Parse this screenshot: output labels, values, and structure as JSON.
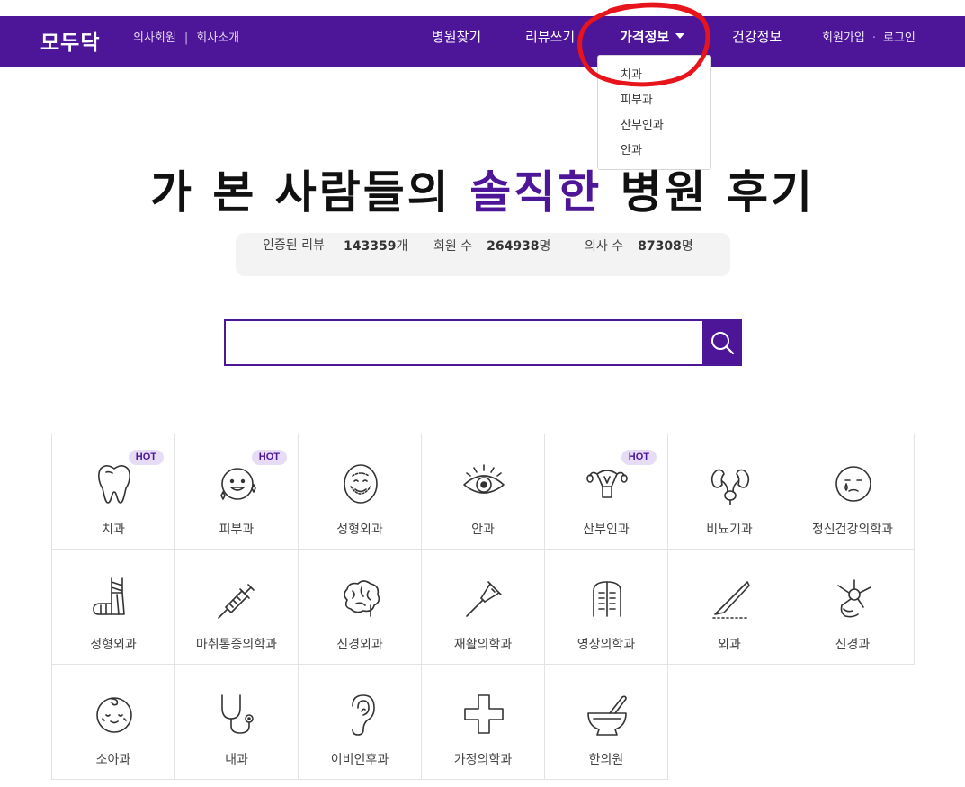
{
  "header": {
    "logo": "모두닥",
    "sub_links": [
      "의사회원",
      "회사소개"
    ],
    "sub_separator": "|",
    "nav": {
      "hospital": "병원찾기",
      "review": "리뷰쓰기",
      "price": "가격정보",
      "health": "건강정보"
    },
    "signup": "회원가입",
    "dot": "·",
    "login": "로그인"
  },
  "price_dropdown": {
    "items": [
      "치과",
      "피부과",
      "산부인과",
      "안과"
    ]
  },
  "hero": {
    "title_before": "가 본 사람들의 ",
    "title_accent": "솔직한",
    "title_after": " 병원 후기",
    "accent_color": "#4d1699"
  },
  "stats": {
    "reviews_label": "인증된 리뷰",
    "reviews_value": "143359",
    "reviews_unit": "개",
    "members_label": "회원 수",
    "members_value": "264938",
    "members_unit": "명",
    "doctors_label": "의사 수",
    "doctors_value": "87308",
    "doctors_unit": "명"
  },
  "search": {
    "placeholder": "",
    "value": ""
  },
  "categories": [
    {
      "label": "치과",
      "icon": "tooth-icon",
      "hot": true
    },
    {
      "label": "피부과",
      "icon": "sparkle-face-icon",
      "hot": true
    },
    {
      "label": "성형외과",
      "icon": "surgery-face-icon",
      "hot": false
    },
    {
      "label": "안과",
      "icon": "eye-icon",
      "hot": false
    },
    {
      "label": "산부인과",
      "icon": "uterus-icon",
      "hot": true
    },
    {
      "label": "비뇨기과",
      "icon": "kidney-icon",
      "hot": false
    },
    {
      "label": "정신건강의학과",
      "icon": "crying-face-icon",
      "hot": false
    },
    {
      "label": "정형외과",
      "icon": "cast-leg-icon",
      "hot": false
    },
    {
      "label": "마취통증의학과",
      "icon": "syringe-icon",
      "hot": false
    },
    {
      "label": "신경외과",
      "icon": "brain-icon",
      "hot": false
    },
    {
      "label": "재활의학과",
      "icon": "crutch-icon",
      "hot": false
    },
    {
      "label": "영상의학과",
      "icon": "xray-icon",
      "hot": false
    },
    {
      "label": "외과",
      "icon": "scalpel-icon",
      "hot": false
    },
    {
      "label": "신경과",
      "icon": "neuron-icon",
      "hot": false
    },
    {
      "label": "소아과",
      "icon": "baby-face-icon",
      "hot": false
    },
    {
      "label": "내과",
      "icon": "stethoscope-icon",
      "hot": false
    },
    {
      "label": "이비인후과",
      "icon": "ear-icon",
      "hot": false
    },
    {
      "label": "가정의학과",
      "icon": "cross-icon",
      "hot": false
    },
    {
      "label": "한의원",
      "icon": "mortar-icon",
      "hot": false
    }
  ],
  "hot_label": "HOT",
  "colors": {
    "brand": "#4d1699",
    "annotation": "#e8141c"
  }
}
